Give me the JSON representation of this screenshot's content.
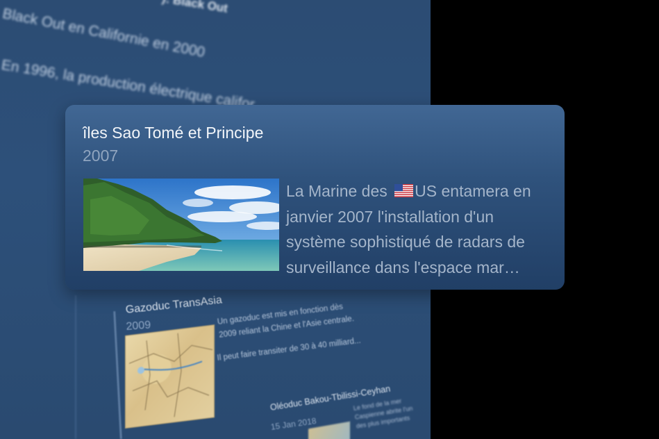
{
  "background": {
    "header_fragment": "): Black Out",
    "heading_line": "Black Out en Californie en 2000",
    "body_line": "En 1996, la production électrique califor",
    "gazoduc": {
      "title": "Gazoduc TransAsia",
      "year": "2009",
      "description": "Un gazoduc est mis en fonction dès 2009 reliant la Chine et l'Asie centrale.",
      "more": "Il peut faire transiter de 30 à 40 milliard..."
    },
    "oleoduc": {
      "title": "Oléoduc Bakou-Tbilissi-Ceyhan",
      "date": "15 Jan 2018",
      "description": "Le fond de la mer Caspienne abrite l'un des plus importants"
    }
  },
  "card": {
    "title": "îles Sao Tomé et Principe",
    "year": "2007",
    "desc_before_flag": "La Marine des ",
    "flag_icon": "us-flag-icon",
    "desc_after_flag": "US entamera en janvier 2007 l'installation d'un système sophistiqué de radars de surveillance dans l'espace mar…"
  },
  "colors": {
    "page_background": "#000000",
    "card_top": "#416794",
    "card_bottom": "#213f66",
    "title": "#f2f5f9",
    "muted": "#90a5bf"
  }
}
